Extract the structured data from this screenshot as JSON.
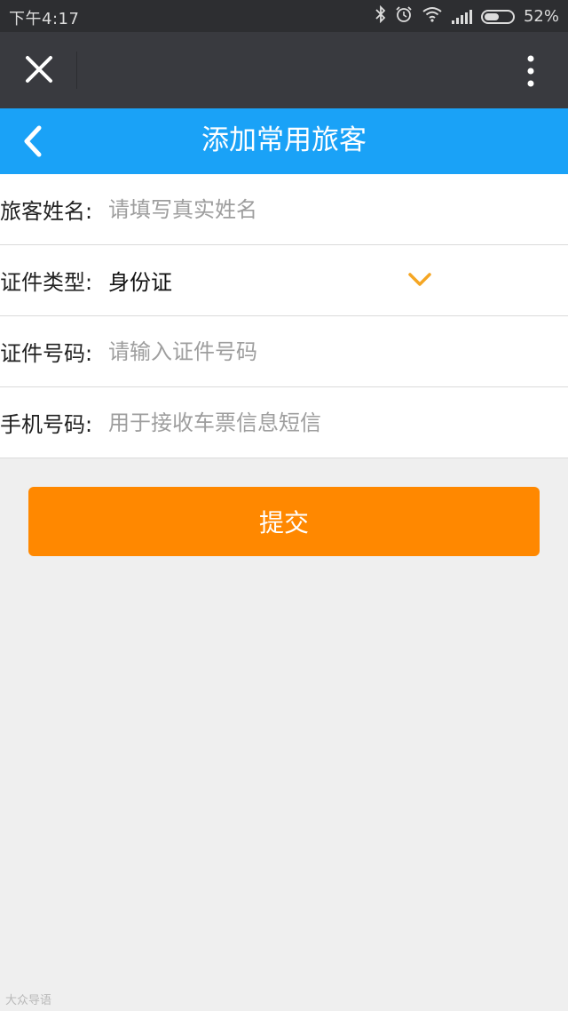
{
  "status_bar": {
    "time": "下午4:17",
    "battery": "52%",
    "battery_level": 0.52,
    "icons": [
      "bluetooth-icon",
      "alarm-icon",
      "wifi-icon",
      "signal-icon",
      "battery-icon"
    ]
  },
  "webview_bar": {
    "close_icon": "close-icon",
    "more_icon": "more-vertical-icon"
  },
  "header": {
    "back_icon": "back-icon",
    "title": "添加常用旅客"
  },
  "form": {
    "name": {
      "label": "旅客姓名:",
      "value": "",
      "placeholder": "请填写真实姓名"
    },
    "id_type": {
      "label": "证件类型:",
      "value": "身份证",
      "icon": "chevron-down-icon"
    },
    "id_number": {
      "label": "证件号码:",
      "value": "",
      "placeholder": "请输入证件号码"
    },
    "phone": {
      "label": "手机号码:",
      "value": "",
      "placeholder": "用于接收车票信息短信"
    }
  },
  "submit_label": "提交",
  "watermark": "大众导语",
  "colors": {
    "header_blue": "#1aa2f7",
    "submit_orange": "#ff8800",
    "chevron_orange": "#f5a623",
    "webview_bar": "#393a3f",
    "status_bar": "#2d2e31",
    "background": "#efefef"
  }
}
